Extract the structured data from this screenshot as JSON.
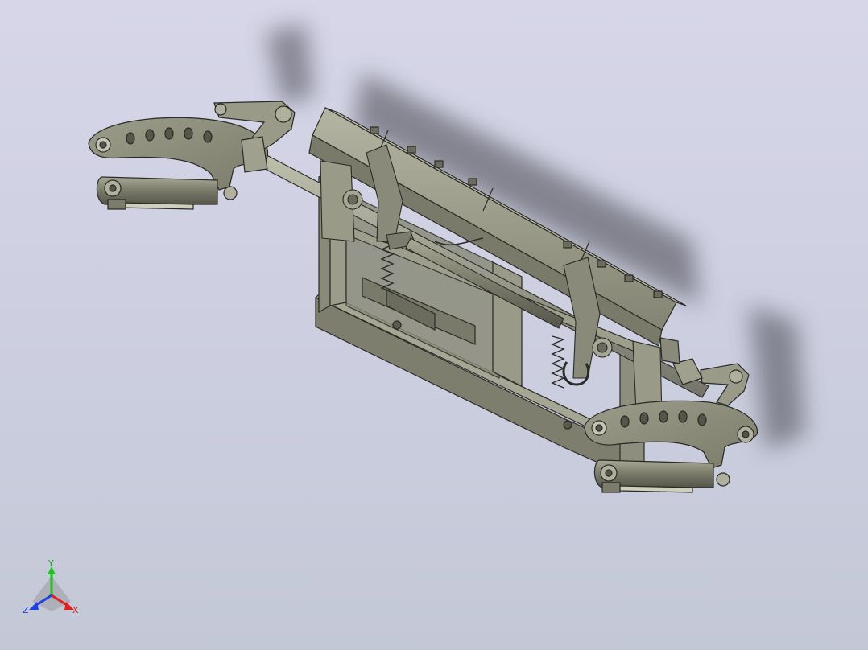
{
  "viewport": {
    "background_top": "#d6d6e8",
    "background_bottom": "#c3c8d6",
    "model_color": "#8e8e7c",
    "model_dark": "#6a6a5c",
    "model_light": "#b2b2a0",
    "edge_color": "#2a2a26"
  },
  "triad": {
    "x_label": "X",
    "y_label": "Y",
    "z_label": "Z",
    "x_color": "#e02020",
    "y_color": "#20c020",
    "z_color": "#2040e0"
  }
}
